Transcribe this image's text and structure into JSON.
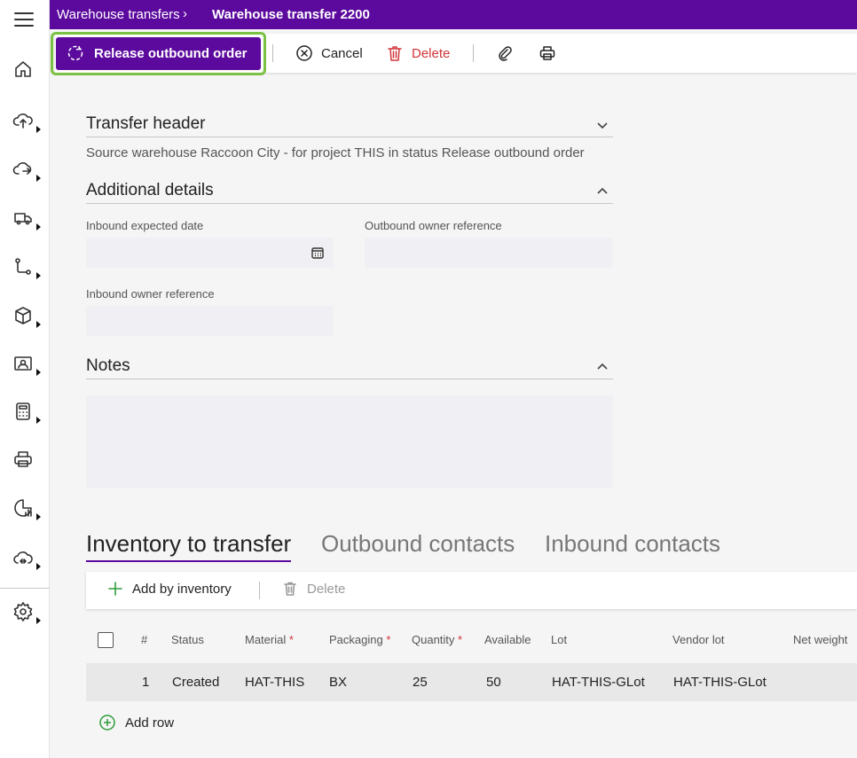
{
  "breadcrumb": {
    "parent": "Warehouse transfers",
    "separator": "›",
    "current": "Warehouse transfer 2200"
  },
  "toolbar": {
    "release_label": "Release outbound order",
    "cancel_label": "Cancel",
    "delete_label": "Delete",
    "attach_icon": "paperclip-icon",
    "print_icon": "printer-icon"
  },
  "rail": {
    "items": [
      "home-icon",
      "cloud-upload-icon",
      "cloud-sync-icon",
      "truck-icon",
      "workflow-icon",
      "box-icon",
      "contact-card-icon",
      "calculator-icon",
      "printer-icon",
      "chart-icon",
      "cloud-transfer-icon",
      "settings-icon"
    ]
  },
  "transfer_header": {
    "title": "Transfer header",
    "summary": "Source warehouse Raccoon City - for project THIS in status Release outbound order"
  },
  "additional_details": {
    "title": "Additional details",
    "inbound_expected_date_label": "Inbound expected date",
    "inbound_expected_date_value": "",
    "outbound_owner_reference_label": "Outbound owner reference",
    "outbound_owner_reference_value": "",
    "inbound_owner_reference_label": "Inbound owner reference",
    "inbound_owner_reference_value": ""
  },
  "notes": {
    "title": "Notes",
    "value": ""
  },
  "tabs": [
    {
      "label": "Inventory to transfer",
      "active": true
    },
    {
      "label": "Outbound contacts",
      "active": false
    },
    {
      "label": "Inbound contacts",
      "active": false
    }
  ],
  "grid": {
    "toolbar": {
      "add_label": "Add by inventory",
      "delete_label": "Delete"
    },
    "columns": {
      "index": "#",
      "status": "Status",
      "material": "Material",
      "packaging": "Packaging",
      "quantity": "Quantity",
      "available": "Available",
      "lot": "Lot",
      "vendor_lot": "Vendor lot",
      "net_weight": "Net weight",
      "required_mark": "*"
    },
    "rows": [
      {
        "index": "1",
        "status": "Created",
        "material": "HAT-THIS",
        "packaging": "BX",
        "quantity": "25",
        "available": "50",
        "lot": "HAT-THIS-GLot",
        "vendor_lot": "HAT-THIS-GLot",
        "net_weight": ""
      }
    ],
    "add_row_label": "Add row"
  },
  "colors": {
    "brand": "#5c0a9e",
    "highlight": "#7ac143",
    "danger": "#d13438",
    "add": "#2e9c3a"
  }
}
